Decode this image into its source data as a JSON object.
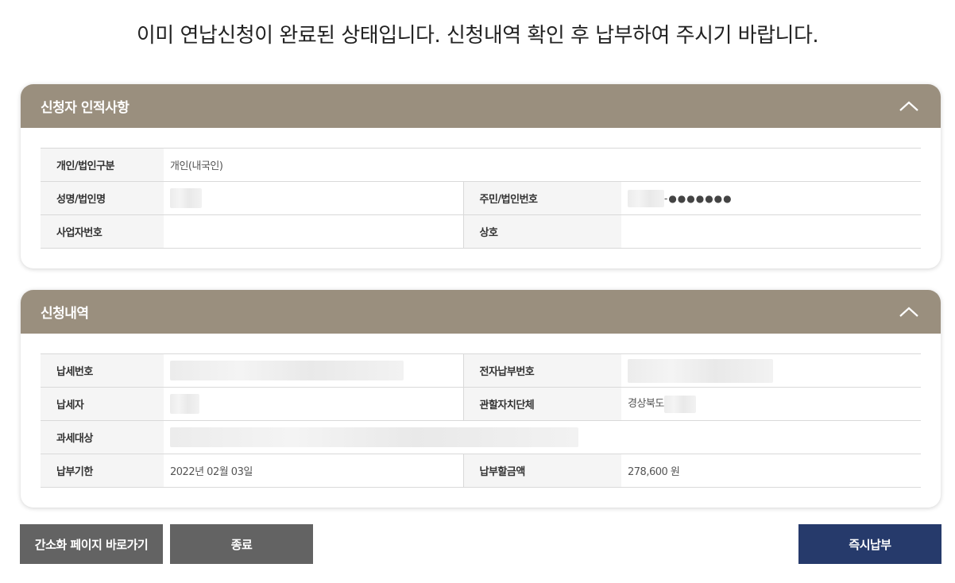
{
  "notice": "이미 연납신청이 완료된 상태입니다. 신청내역 확인 후 납부하여 주시기 바랍니다.",
  "applicant": {
    "title": "신청자 인적사항",
    "type_label": "개인/법인구분",
    "type_value": "개인(내국인)",
    "name_label": "성명/법인명",
    "id_label": "주민/법인번호",
    "id_masked": "-●●●●●●●",
    "bizno_label": "사업자번호",
    "company_label": "상호"
  },
  "details": {
    "title": "신청내역",
    "taxno_label": "납세번호",
    "epayno_label": "전자납부번호",
    "payer_label": "납세자",
    "region_label": "관할자치단체",
    "region_value": "경상북도",
    "object_label": "과세대상",
    "due_label": "납부기한",
    "due_value": "2022년 02월 03일",
    "amount_label": "납부할금액",
    "amount_value": "278,600 원"
  },
  "buttons": {
    "simple": "간소화 페이지 바로가기",
    "close": "종료",
    "pay": "즉시납부"
  },
  "colors": {
    "panel_header": "#9a8f7e",
    "button_gray": "#636363",
    "button_navy": "#263a6b"
  }
}
